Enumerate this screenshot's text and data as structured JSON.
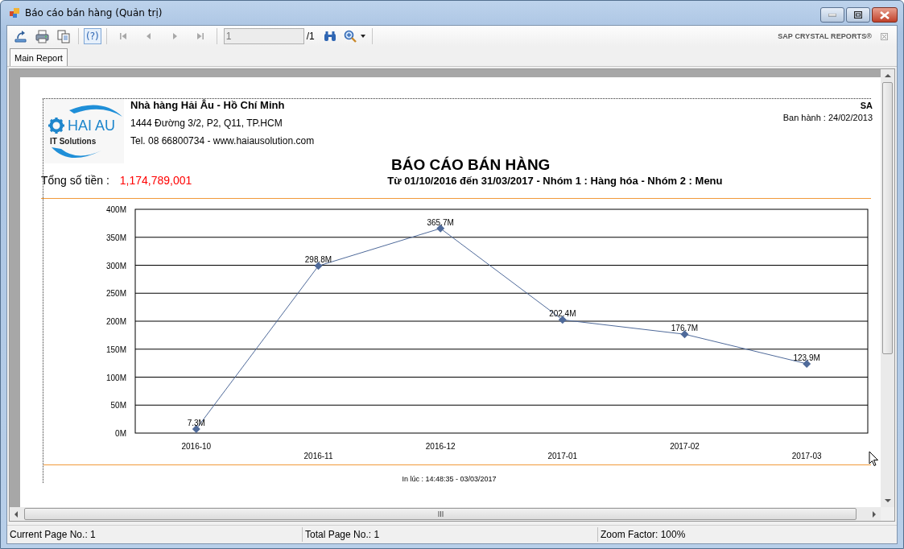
{
  "window": {
    "title": "Báo cáo bán hàng (Quản trị)"
  },
  "toolbar": {
    "tools": [
      {
        "kind": "export"
      },
      {
        "kind": "print"
      },
      {
        "kind": "copy"
      }
    ],
    "help_label": "(?)",
    "nav_buttons": [
      {
        "kind": "first",
        "disabled": true
      },
      {
        "kind": "prev",
        "disabled": true
      },
      {
        "kind": "next",
        "disabled": true
      },
      {
        "kind": "last",
        "disabled": true
      }
    ],
    "page_field": {
      "value": "1"
    },
    "page_total": "/1",
    "brand": "SAP CRYSTAL REPORTS®"
  },
  "tabs": [
    {
      "label": "Main Report",
      "selected": true
    }
  ],
  "report": {
    "logo": {
      "name": "HAI AU",
      "tagline": "IT Solutions"
    },
    "company": "Nhà hàng Hải Âu - Hồ Chí Minh",
    "address": "1444 Đường 3/2, P2, Q11, TP.HCM",
    "contact": "Tel. 08 66800734 - www.haiausolution.com",
    "code": "SA",
    "issued": "Ban hành : 24/02/2013",
    "title": "BÁO CÁO BÁN HÀNG",
    "total_label": "Tổng số tiền :",
    "total_value": "1,174,789,001",
    "subtitle": "Từ 01/10/2016 đến 31/03/2017 - Nhóm 1 : Hàng hóa - Nhóm 2 : Menu",
    "chart_data": {
      "type": "line",
      "categories": [
        "2016-10",
        "2016-11",
        "2016-12",
        "2017-01",
        "2017-02",
        "2017-03"
      ],
      "series": [
        {
          "color": "#4f6a9a",
          "marker": "diamond",
          "values": [
            7.3,
            298.8,
            365.7,
            202.4,
            176.7,
            123.9
          ]
        }
      ],
      "grid": true,
      "ylim": [
        0,
        400
      ],
      "yticks": [
        {
          "value": 0,
          "label": "0M"
        },
        {
          "value": 50,
          "label": "50M"
        },
        {
          "value": 100,
          "label": "100M"
        },
        {
          "value": 150,
          "label": "150M"
        },
        {
          "value": 200,
          "label": "200M"
        },
        {
          "value": 250,
          "label": "250M"
        },
        {
          "value": 300,
          "label": "300M"
        },
        {
          "value": 350,
          "label": "350M"
        },
        {
          "value": 400,
          "label": "400M"
        }
      ],
      "value_labels": [
        "7.3M",
        "298.8M",
        "365.7M",
        "202.4M",
        "176.7M",
        "123.9M"
      ]
    },
    "printed_at": "In lúc : 14:48:35 - 03/03/2017"
  },
  "status_bar": [
    "Current Page No.: 1",
    "Total Page No.: 1",
    "Zoom Factor: 100%"
  ]
}
